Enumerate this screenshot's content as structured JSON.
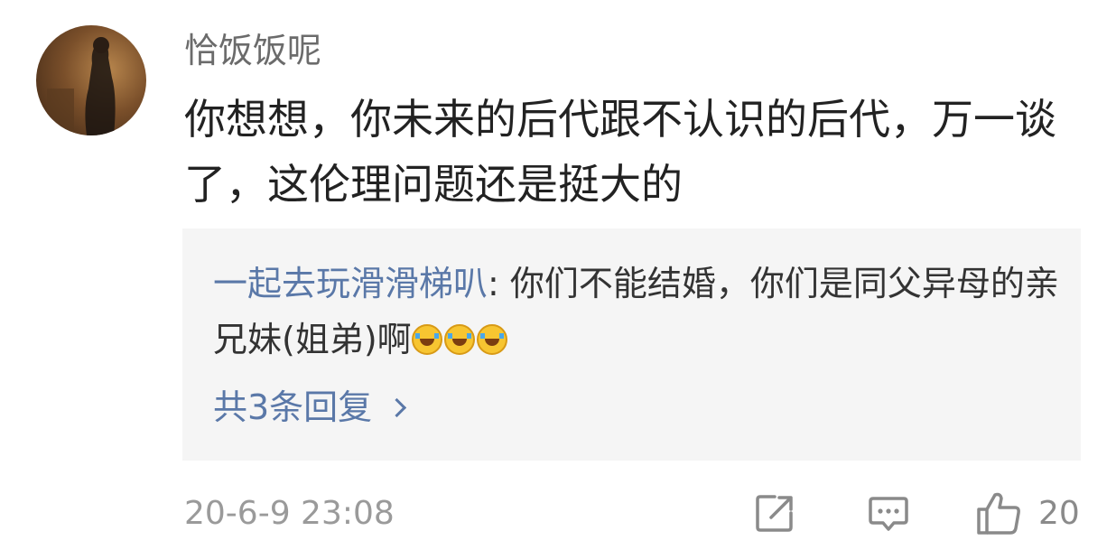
{
  "comment": {
    "username": "恰饭饭呢",
    "text": "你想想，你未来的后代跟不认识的后代，万一谈了，这伦理问题还是挺大的",
    "timestamp": "20-6-9 23:08",
    "like_count": "20"
  },
  "reply_preview": {
    "author": "一起去玩滑滑梯叭",
    "separator": ": ",
    "text": "你们不能结婚，你们是同父异母的亲兄妹(姐弟)啊",
    "emoji": [
      "crying-laughing-emoji",
      "crying-laughing-emoji",
      "crying-laughing-emoji"
    ],
    "more_replies": "共3条回复"
  },
  "icons": {
    "share": "share-edit-icon",
    "reply": "comment-bubble-icon",
    "like": "thumbs-up-icon",
    "more": "chevron-right-icon"
  },
  "colors": {
    "link": "#5a78a8",
    "muted": "#9a9a9a",
    "reply_background": "#f5f5f5"
  }
}
